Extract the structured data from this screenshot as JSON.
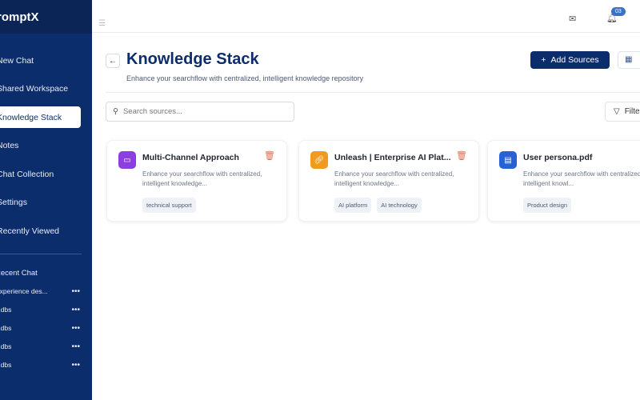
{
  "brand": "PromptX",
  "nav": [
    "New Chat",
    "Shared Workspace",
    "Knowledge Stack",
    "Notes",
    "Chat Collection",
    "Settings",
    "Recently Viewed"
  ],
  "recent_title": "Recent Chat",
  "recent": [
    "Experience des...",
    "s dbs",
    "s dbs",
    "s dbs",
    "s dbs"
  ],
  "notifications": "03",
  "page": {
    "title": "Knowledge Stack",
    "subtitle": "Enhance your searchflow with centralized, intelligent knowledge repository",
    "add_label": "Add Sources",
    "filter_label": "Filter",
    "search_placeholder": "Search sources..."
  },
  "cards": [
    {
      "title": "Multi-Channel Approach",
      "desc": "Enhance your searchflow with centralized, intelligent knowledge...",
      "tags": [
        "technical support"
      ],
      "color": "#8b3fe0",
      "icon": "channel-icon"
    },
    {
      "title": "Unleash | Enterprise AI Plat...",
      "desc": "Enhance your searchflow with centralized, intelligent knowledge...",
      "tags": [
        "AI platform",
        "AI technology"
      ],
      "color": "#f09a1e",
      "icon": "link-icon"
    },
    {
      "title": "User persona.pdf",
      "desc": "Enhance your searchflow with centralized, intelligent knowl...",
      "tags": [
        "Product design"
      ],
      "color": "#2563d6",
      "icon": "document-icon"
    }
  ]
}
